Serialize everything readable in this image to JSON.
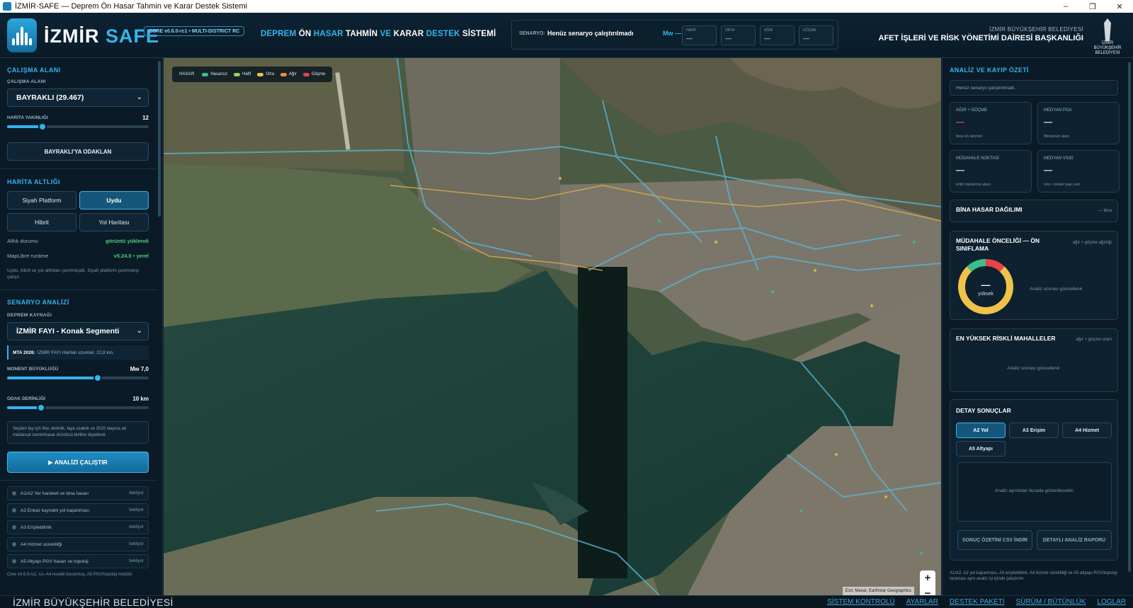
{
  "window": {
    "title": "İZMİR-SAFE — Deprem Ön Hasar Tahmin ve Karar Destek Sistemi"
  },
  "header": {
    "brand_white": "İZMİR",
    "brand_blue": "SAFE",
    "core_badge": "CORE v0.6.0-rc1 • MULTI-DISTRICT RC",
    "system_title": [
      "DEPREM",
      "ÖN",
      "HASAR",
      "TAHMİN",
      "VE",
      "KARAR",
      "DESTEK",
      "SİSTEMİ"
    ],
    "scenario_label": "SENARYO:",
    "scenario_value": "Henüz senaryo çalıştırılmadı",
    "mw_label": "Mw —",
    "stats": [
      {
        "key": "HAFİF",
        "value": "—"
      },
      {
        "key": "ORTA",
        "value": "—"
      },
      {
        "key": "AĞIR",
        "value": "—"
      },
      {
        "key": "GÖÇME",
        "value": "—"
      }
    ],
    "org_line1": "İZMİR BÜYÜKŞEHİR BELEDİYESİ",
    "org_line2": "AFET İŞLERİ VE RİSK YÖNETİMİ DAİRESİ BAŞKANLIĞI",
    "emblem_text": "İZMİR BÜYÜKŞEHİR BELEDİYESİ"
  },
  "left": {
    "work_area_title": "ÇALIŞMA ALANI",
    "work_area_label": "ÇALIŞMA ALANI",
    "work_area_value": "BAYRAKLI (29.467)",
    "zoom_label": "HARİTA YAKINLIĞI",
    "zoom_value": "12",
    "zoom_fraction": 0.25,
    "focus_button": "BAYRAKLI'YA ODAKLAN",
    "basemap_title": "HARİTA ALTLIĞI",
    "basemaps": [
      "Siyah Platform",
      "Uydu",
      "Hibrit",
      "Yol Haritası"
    ],
    "basemap_active": "Uydu",
    "basemap_status_key": "Altlık durumu",
    "basemap_status_val": "görüntü yüklendi",
    "runtime_key": "MapLibre runtime",
    "runtime_val": "v5.24.0 • yerel",
    "basemap_note": "Uydu, hibrit ve yol altlıkları çevrimiçidir. Siyah platform çevrimdışı çalışır.",
    "scenario_title": "SENARYO ANALİZİ",
    "source_label": "DEPREM KAYNAĞI",
    "source_value": "İZMİR FAYI - Konak Segmenti",
    "mta_bold": "MTA 2026:",
    "mta_text": "İZMİR FAYI Haritalı uzunluk: 22,8 km.",
    "magnitude_label": "MOMENT BÜYÜKLÜĞÜ",
    "magnitude_value": "Mw 7,0",
    "magnitude_fraction": 0.64,
    "depth_label": "ODAK DERİNLİĞİ",
    "depth_value": "10 km",
    "depth_fraction": 0.24,
    "scenario_desc": "Seçilen fay için Mw, derinlik, faya uzaklık ve 2020 olayına ait mekânsal zemin/hasar örüntüsü birlikte ölçeklenir.",
    "run_button": "▶ ANALİZİ ÇALIŞTIR",
    "steps": [
      {
        "label": "A1/A2 Yer hareketi ve bina hasarı",
        "status": "bekliyor"
      },
      {
        "label": "A2 Enkaz kaynaklı yol kapanması",
        "status": "bekliyor"
      },
      {
        "label": "A3 Erişilebilirlik",
        "status": "bekliyor"
      },
      {
        "label": "A4 Hizmet sürekliliği",
        "status": "bekliyor"
      },
      {
        "label": "A5 Altyapı PGV hasarı ve topoloji",
        "status": "bekliyor"
      }
    ],
    "footer_note": "Core v0.6.0-rc1: A1–A4 modeli korunmuş, A5 PGV/topoloji modülü"
  },
  "map": {
    "legend_title": "HASAR",
    "legend": [
      {
        "label": "Hasarsız",
        "color": "#3bbf8a"
      },
      {
        "label": "Hafif",
        "color": "#8ed35a"
      },
      {
        "label": "Orta",
        "color": "#f0c24a"
      },
      {
        "label": "Ağır",
        "color": "#f08a3a"
      },
      {
        "label": "Göçme",
        "color": "#e8434a"
      }
    ],
    "zoom_in": "+",
    "zoom_out": "−",
    "attribution": "Esri, Maxar, Earthstar Geographics"
  },
  "right": {
    "summary_title": "ANALİZ VE KAYIP ÖZETİ",
    "summary_status": "Henüz senaryo çalıştırılmadı.",
    "metrics": [
      {
        "key": "AĞIR + GÖÇME",
        "value": "—",
        "sub": "bina ön tahmini"
      },
      {
        "key": "MEDYAN PGA",
        "value": "—",
        "sub": "filtrelenen alan"
      },
      {
        "key": "MÜDAHALE NOKTASI",
        "value": "—",
        "sub": "kritik toplanma alanı"
      },
      {
        "key": "MEDYAN VS30",
        "value": "—",
        "sub": "m/s • model yapı seti"
      }
    ],
    "damage_dist_title": "BİNA HASAR DAĞILIMI",
    "damage_dist_aside": "— bina",
    "priority_title": "MÜDAHALE ÖNCELİĞİ — ÖN SINIFLAMA",
    "priority_aside": "ağır + göçme ağırlığı",
    "donut_value": "—",
    "donut_label": "yüksek",
    "donut_segments": [
      {
        "color": "#e8434a",
        "fraction": 0.12
      },
      {
        "color": "#f0c24a",
        "fraction": 0.76
      },
      {
        "color": "#3bbf8a",
        "fraction": 0.12
      }
    ],
    "priority_note": "Analiz sonrası güncellenir.",
    "risky_title": "EN YÜKSEK RİSKLİ MAHALLELER",
    "risky_aside": "ağır + göçme oranı",
    "risky_note": "Analiz sonrası güncellenir.",
    "detail_title": "DETAY SONUÇLAR",
    "detail_tabs": [
      "A2 Yol",
      "A3 Erişim",
      "A4 Hizmet",
      "A5 Altyapı"
    ],
    "detail_active": "A2 Yol",
    "detail_placeholder": "Analiz ayrıntıları burada gösterilecektir.",
    "csv_button": "SONUÇ ÖZETİNİ CSV İNDİR",
    "report_button": "DETAYLI ANALİZ RAPORU",
    "bottom_note": "A1/A2, A2 yol kapanması, A3 erişilebilirlik, A4 hizmet sürekliliği ve A5 altyapı PGV/topoloji taraması aynı analiz işi içinde çalıştırılır."
  },
  "bottombar": {
    "org": "İZMİR BÜYÜKŞEHİR BELEDİYESİ",
    "links": [
      "SİSTEM KONTROLÜ",
      "AYARLAR",
      "DESTEK PAKETİ",
      "SÜRÜM / BÜTÜNLÜK",
      "LOGLAR"
    ]
  }
}
